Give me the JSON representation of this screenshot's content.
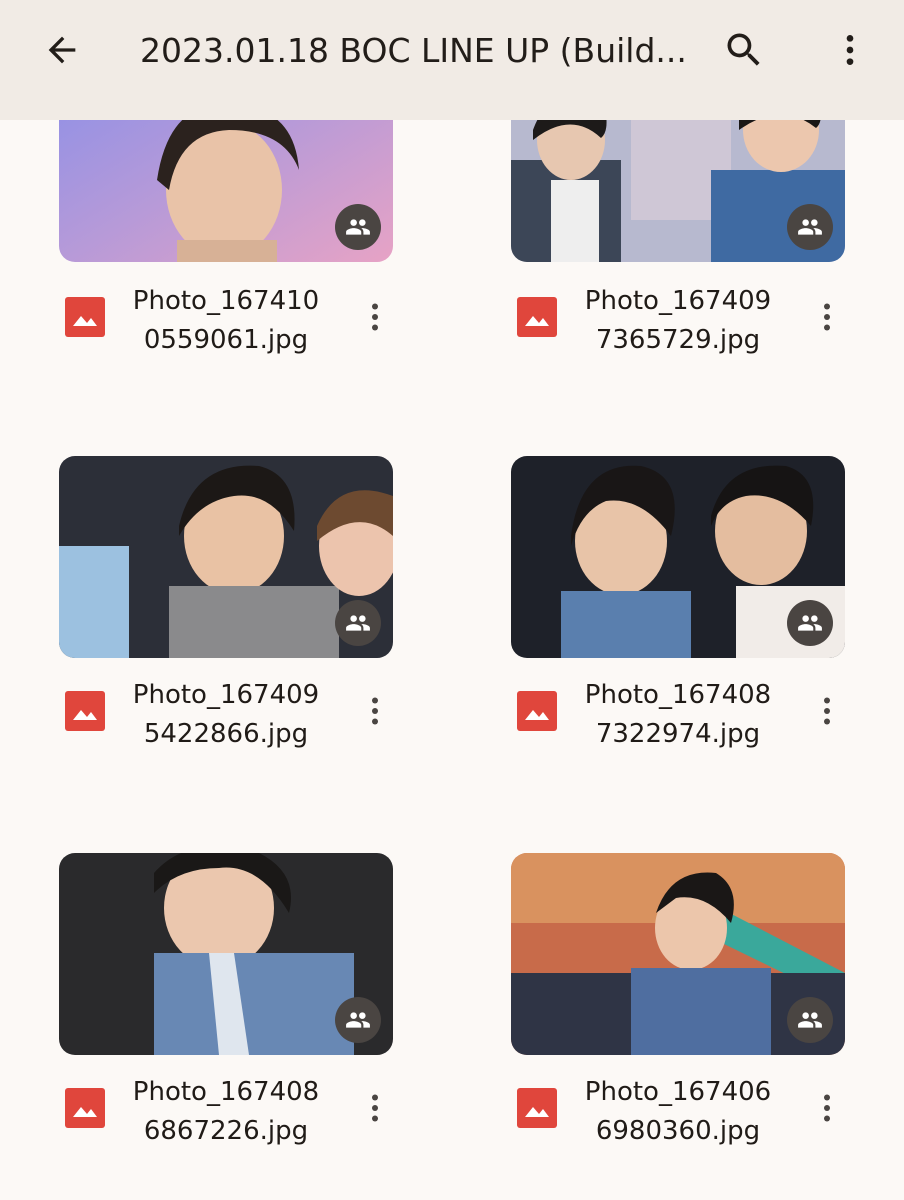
{
  "header": {
    "title": "2023.01.18 BOC LINE UP (Build...",
    "back_icon": "arrow-back-icon",
    "search_icon": "search-icon",
    "more_icon": "more-vert-icon"
  },
  "files": [
    {
      "name_line1": "Photo_167410",
      "name_line2": "0559061.jpg",
      "shared": true
    },
    {
      "name_line1": "Photo_167409",
      "name_line2": "7365729.jpg",
      "shared": true
    },
    {
      "name_line1": "Photo_167409",
      "name_line2": "5422866.jpg",
      "shared": true
    },
    {
      "name_line1": "Photo_167408",
      "name_line2": "7322974.jpg",
      "shared": true
    },
    {
      "name_line1": "Photo_167408",
      "name_line2": "6867226.jpg",
      "shared": true
    },
    {
      "name_line1": "Photo_167406",
      "name_line2": "6980360.jpg",
      "shared": true
    }
  ],
  "colors": {
    "appbar": "#f1ebe5",
    "background": "#fcf9f6",
    "image_file_icon": "#e0463c",
    "shared_badge": "#4a4542"
  }
}
